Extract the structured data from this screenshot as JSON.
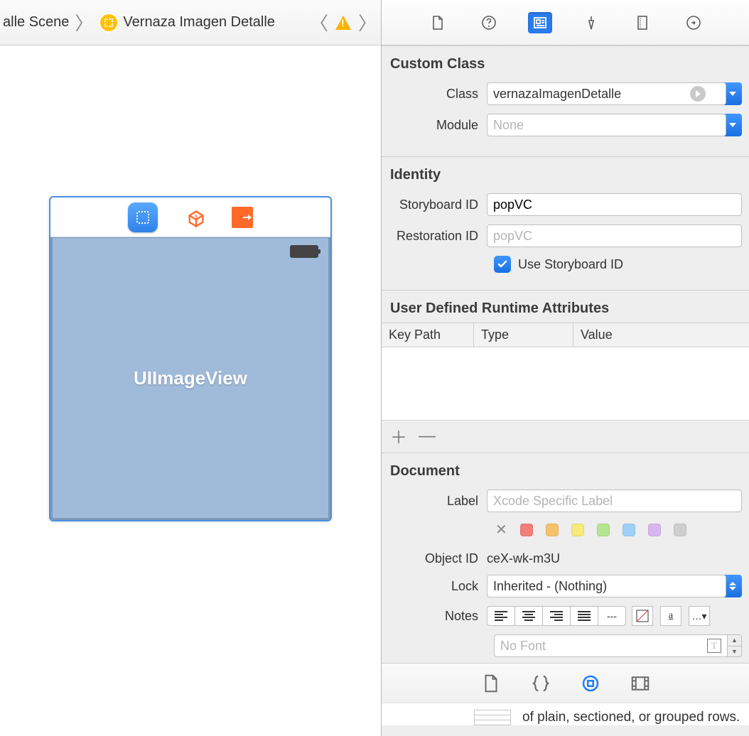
{
  "breadcrumb": {
    "scene_suffix": "alle Scene",
    "item": "Vernaza Imagen Detalle"
  },
  "canvas": {
    "placeholder": "UIImageView"
  },
  "inspector": {
    "custom_class": {
      "title": "Custom Class",
      "class_label": "Class",
      "class_value": "vernazaImagenDetalle",
      "module_label": "Module",
      "module_placeholder": "None"
    },
    "identity": {
      "title": "Identity",
      "storyboard_label": "Storyboard ID",
      "storyboard_value": "popVC",
      "restoration_label": "Restoration ID",
      "restoration_placeholder": "popVC",
      "use_sb_label": "Use Storyboard ID"
    },
    "udra": {
      "title": "User Defined Runtime Attributes",
      "col_keypath": "Key Path",
      "col_type": "Type",
      "col_value": "Value"
    },
    "document": {
      "title": "Document",
      "label_label": "Label",
      "label_placeholder": "Xcode Specific Label",
      "object_id_label": "Object ID",
      "object_id_value": "ceX-wk-m3U",
      "lock_label": "Lock",
      "lock_value": "Inherited - (Nothing)",
      "notes_label": "Notes",
      "nofont": "No Font",
      "swatch_colors": [
        "#f27f78",
        "#f7c36a",
        "#f6ea7b",
        "#b6e592",
        "#9fd0f6",
        "#d9b5ee",
        "#cfcfcf"
      ]
    }
  },
  "library": {
    "snippet": "of plain, sectioned, or grouped rows."
  }
}
